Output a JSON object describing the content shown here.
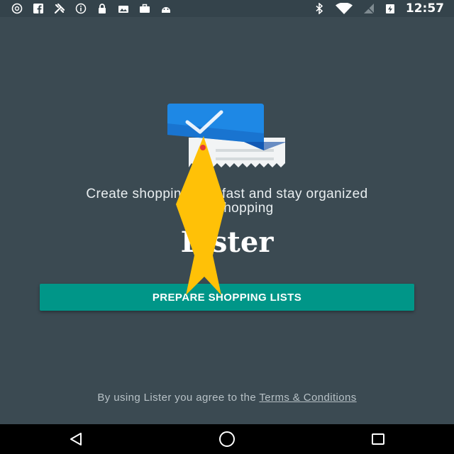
{
  "status_bar": {
    "time": "12:57",
    "left_icons": [
      "aperture-icon",
      "facebook-icon",
      "tools-icon",
      "info-icon",
      "lock-icon",
      "photo-icon",
      "briefcase-icon",
      "android-icon"
    ],
    "right_icons": [
      "bluetooth-icon",
      "wifi-icon",
      "signal-icon",
      "battery-charging-icon"
    ]
  },
  "main": {
    "tagline_line1": "Create shopping lists fast and stay organized",
    "tagline_line2": "while shopping",
    "app_title": "Lister",
    "cta_label": "PREPARE SHOPPING LISTS",
    "terms_prefix": "By using Lister you agree to the ",
    "terms_link": "Terms & Conditions"
  },
  "colors": {
    "background": "#3b4a52",
    "button": "#009688",
    "logo_blue": "#1976d2",
    "pointer": "#ffc107"
  },
  "nav_bar": {
    "buttons": [
      "back-icon",
      "home-icon",
      "recents-icon"
    ]
  }
}
